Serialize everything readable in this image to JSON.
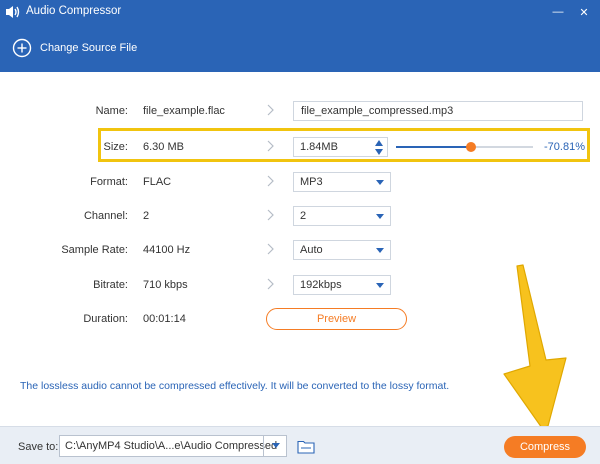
{
  "window": {
    "title": "Audio Compressor",
    "minimize_label": "—",
    "close_label": "✕"
  },
  "header": {
    "change_source_label": "Change Source File"
  },
  "fields": {
    "name": {
      "label": "Name:",
      "source": "file_example.flac",
      "target": "file_example_compressed.mp3"
    },
    "size": {
      "label": "Size:",
      "source": "6.30 MB",
      "target": "1.84MB",
      "slider_fraction": 0.55,
      "percent": "-70.81%"
    },
    "format": {
      "label": "Format:",
      "source": "FLAC",
      "target": "MP3"
    },
    "channel": {
      "label": "Channel:",
      "source": "2",
      "target": "2"
    },
    "sample_rate": {
      "label": "Sample Rate:",
      "source": "44100 Hz",
      "target": "Auto"
    },
    "bitrate": {
      "label": "Bitrate:",
      "source": "710 kbps",
      "target": "192kbps"
    },
    "duration": {
      "label": "Duration:",
      "source": "00:01:14",
      "preview_label": "Preview"
    }
  },
  "notice": "The lossless audio cannot be compressed effectively. It will be converted to the lossy format.",
  "footer": {
    "save_to_label": "Save to:",
    "save_path": "C:\\AnyMP4 Studio\\A...e\\Audio Compressed",
    "compress_label": "Compress"
  },
  "colors": {
    "accent_blue": "#2a64b6",
    "accent_orange": "#f57c24",
    "highlight_yellow": "#f1c40f",
    "arrow_yellow": "#f7c21e"
  }
}
